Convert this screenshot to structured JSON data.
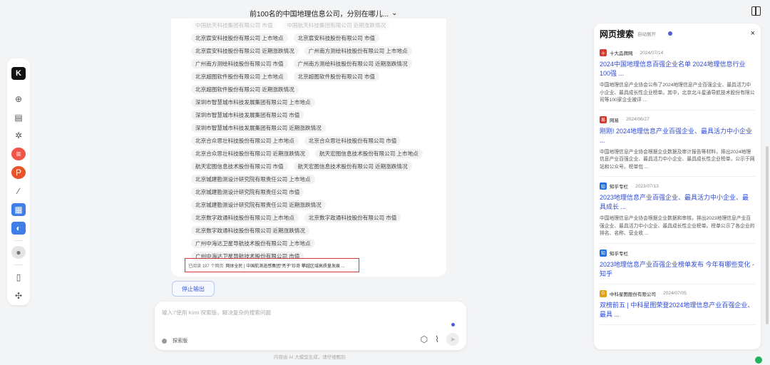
{
  "header": {
    "title": "前100名的中国地理信息公司，分别在哪儿...",
    "chevron": "⌄"
  },
  "rail": {
    "logo": "K",
    "icons": [
      "new-chat-icon",
      "history-icon",
      "explore-icon",
      "app-red-icon",
      "ppt-icon",
      "pen-icon",
      "doc-blue-icon",
      "app-blue-icon",
      "user-icon",
      "phone-icon",
      "puzzle-icon"
    ]
  },
  "chat": {
    "tag_rows": [
      [
        "中国航天科技集团有限公司 市值",
        "中国航天科技集团有限公司 近期涨跌情况"
      ],
      [
        "北京宸安科技股份有限公司 上市地点",
        "北京宸安科技股份有限公司 市值"
      ],
      [
        "北京宸安科技股份有限公司 近期涨跌情况",
        "广州南方测绘科技股份有限公司 上市地点"
      ],
      [
        "广州南方测绘科技股份有限公司 市值",
        "广州南方测绘科技股份有限公司 近期涨跌情况"
      ],
      [
        "北京超图软件股份有限公司 上市地点",
        "北京超图软件股份有限公司 市值"
      ],
      [
        "北京超图软件股份有限公司 近期涨跌情况"
      ],
      [
        "深圳市智慧城市科技发展集团有限公司 上市地点"
      ],
      [
        "深圳市智慧城市科技发展集团有限公司 市值"
      ],
      [
        "深圳市智慧城市科技发展集团有限公司 近期涨跌情况"
      ],
      [
        "北京合众思壮科技股份有限公司 上市地点",
        "北京合众思壮科技股份有限公司 市值"
      ],
      [
        "北京合众思壮科技股份有限公司 近期涨跌情况",
        "航天宏图信息技术股份有限公司 上市地点"
      ],
      [
        "航天宏图信息技术股份有限公司 市值",
        "航天宏图信息技术股份有限公司 近期涨跌情况"
      ],
      [
        "北京城建勘测设计研究院有限责任公司 上市地点"
      ],
      [
        "北京城建勘测设计研究院有限责任公司 市值"
      ],
      [
        "北京城建勘测设计研究院有限责任公司 近期涨跌情况"
      ],
      [
        "北京数字政通科技股份有限公司 上市地点",
        "北京数字政通科技股份有限公司 市值"
      ],
      [
        "北京数字政通科技股份有限公司 近期涨跌情况"
      ],
      [
        "广州中海达卫星导航技术股份有限公司 上市地点"
      ],
      [
        "广州中海达卫星导航技术股份有限公司 市值"
      ]
    ],
    "source_label": "已阅读 197 个网页",
    "source_highlight": "网体全民 | 中国航测遥感集团“亮子”珍奇 攀越区域高质量发展 ..."
  },
  "stop_button": "停止输出",
  "composer": {
    "placeholder": "输入'/'使用 Kimi 探索版，解决复杂的搜索问题",
    "mode_label": "探索版"
  },
  "footnote": "内容由 AI 大模型生成，请仔细甄别",
  "panel": {
    "title": "网页搜索",
    "subtitle": "自动展开",
    "close": "×",
    "results": [
      {
        "site": "十大品牌网",
        "date": "2024/07/14",
        "fav_color": "#d33a2f",
        "fav": "十",
        "title": "2024中国地理信息百强企业名单 2024地理信息行业100强 ...",
        "snippet": "中国地理信息产业协会公布了2024地理信息产业百强企业、最具活力中小企业、最具成长性企业榜单。其中，北京北斗星通导航技术股份有限公司等100家企业被评 ..."
      },
      {
        "site": "网易",
        "date": "2024/06/27",
        "fav_color": "#d33a2f",
        "fav": "易",
        "title": "刚刚! 2024地理信息产业百强企业、最具活力中小企业 ...",
        "snippet": "中国地理信息产业协会根据企业数据及审计报告等材料，排出2024地理信息产业百强企业、最具活力中小企业、最具成长性企业榜单，公示于网站和公众号。榜单包 ..."
      },
      {
        "site": "知乎专栏",
        "date": "2023/07/13",
        "fav_color": "#1f6fe5",
        "fav": "知",
        "title": "2023地理信息产业百强企业、最具活力中小企业、最具成长 ...",
        "snippet": "中国地理信息产业协会根据企业数据和审核，排出2023地理信息产业百强企业、最具活力中小企业、最具成长性企业榜单。榜单公示了各企业的排名、名称、营业收 ..."
      },
      {
        "site": "知乎专栏",
        "date": "",
        "fav_color": "#1f6fe5",
        "fav": "知",
        "title": "2023地理信息产业百强企业榜单发布 今年有哪些变化 - 知乎",
        "snippet": ""
      },
      {
        "site": "中科星图股份有限公司",
        "date": "2024/07/05",
        "fav_color": "#e0a21a",
        "fav": "G",
        "title": "双榜前五 | 中科星图荣登2024地理信息产业百强企业、最具 ...",
        "snippet": ""
      }
    ]
  }
}
